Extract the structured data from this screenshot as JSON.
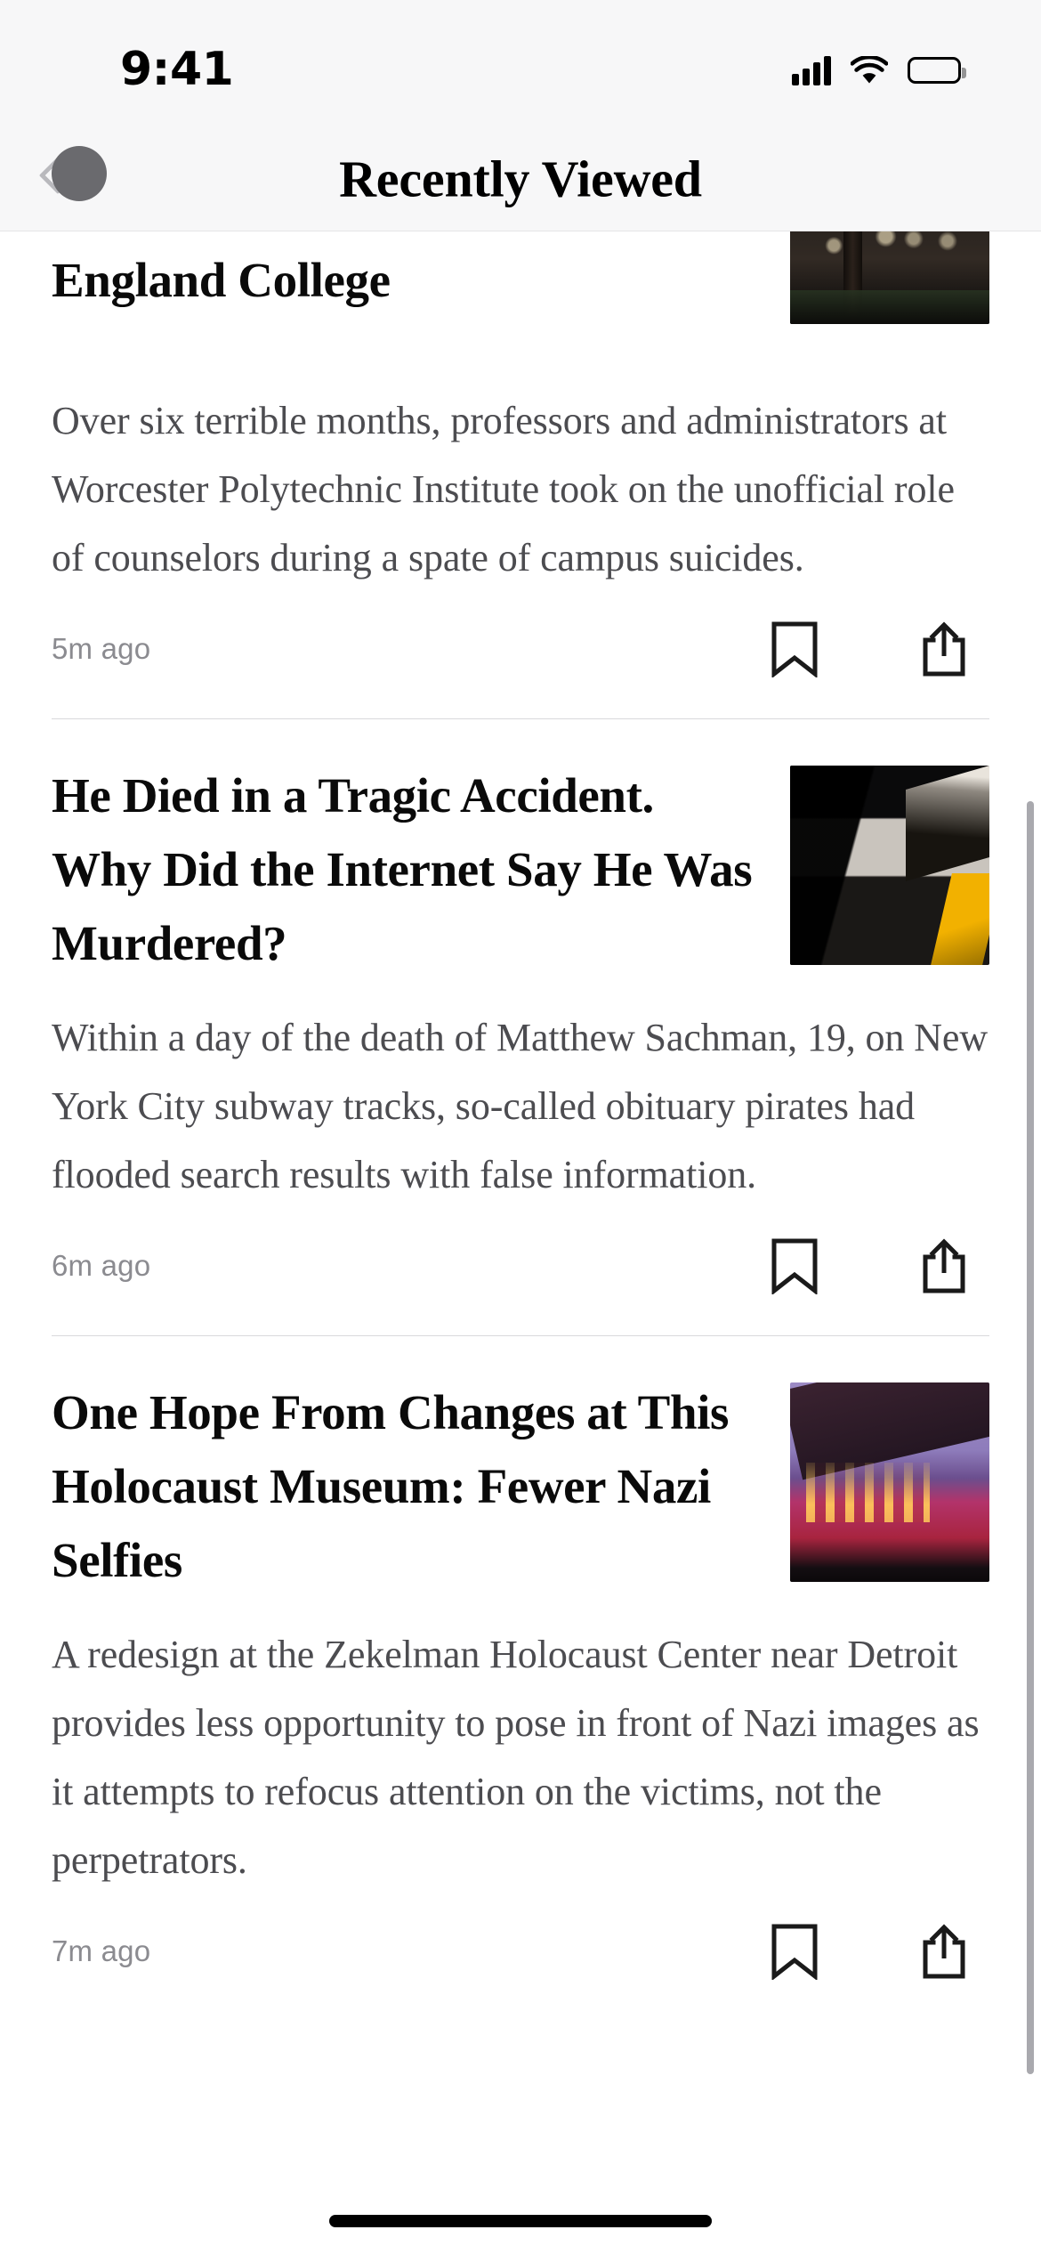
{
  "status_bar": {
    "time": "9:41",
    "cellular_icon": "cellular-bars-icon",
    "wifi_icon": "wifi-icon",
    "battery_icon": "battery-icon"
  },
  "nav": {
    "title": "Recently Viewed",
    "back_icon": "chevron-left-icon",
    "touch_indicator": "touch-point-indicator"
  },
  "articles": [
    {
      "headline": "Health Crisis That Shook a New England College",
      "summary": "Over six terrible months, professors and administrators at Worcester Polytechnic Institute took on the unofficial role of counselors during a spate of campus suicides.",
      "timestamp": "5m ago",
      "thumbnail": "night-campus-walkway-photo",
      "bookmark_icon": "bookmark-icon",
      "share_icon": "share-icon"
    },
    {
      "headline": "He Died in a Tragic Accident. Why Did the Internet Say He Was Murdered?",
      "summary": "Within a day of the death of Matthew Sachman, 19, on New York City subway tracks, so-called obituary pirates had flooded search results with false information.",
      "timestamp": "6m ago",
      "thumbnail": "subway-platform-photo",
      "bookmark_icon": "bookmark-icon",
      "share_icon": "share-icon"
    },
    {
      "headline": "One Hope From Changes at This Holocaust Museum: Fewer Nazi Selfies",
      "summary": "A redesign at the Zekelman Holocaust Center near Detroit provides less opportunity to pose in front of Nazi images as it attempts to refocus attention on the victims, not the perpetrators.",
      "timestamp": "7m ago",
      "thumbnail": "holocaust-museum-facade-photo",
      "bookmark_icon": "bookmark-icon",
      "share_icon": "share-icon"
    }
  ],
  "colors": {
    "chrome_background": "#f7f7f8",
    "page_background": "#ffffff",
    "headline_text": "#0a0a0a",
    "summary_text": "#4c4c50",
    "timestamp_text": "#8b8b90",
    "divider": "#d9d9dc",
    "scrollbar": "#a9a9ae"
  },
  "home_indicator": "home-indicator"
}
